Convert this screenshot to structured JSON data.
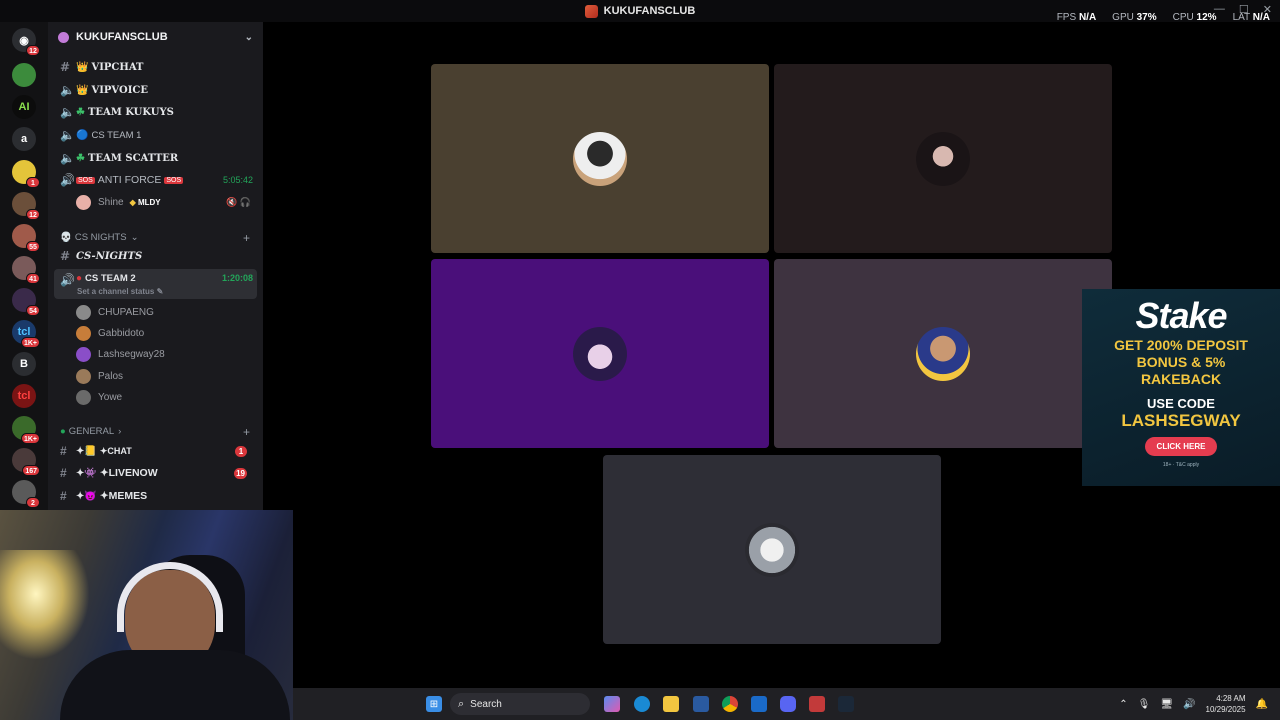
{
  "window": {
    "title": "KUKUFANSCLUB"
  },
  "perf": {
    "fps_label": "FPS",
    "fps": "N/A",
    "gpu_label": "GPU",
    "gpu": "37%",
    "cpu_label": "CPU",
    "cpu": "12%",
    "lat_label": "LAT",
    "lat": "N/A"
  },
  "rail": {
    "badges": [
      "12",
      "1",
      "12",
      "55",
      "41",
      "54",
      "1K+",
      "1K+",
      "167",
      "2"
    ],
    "letters": [
      "a",
      "B"
    ]
  },
  "server": {
    "name": "KUKUFANSCLUB"
  },
  "channels": [
    {
      "label": "VIPCHAT",
      "emoji": "👑"
    },
    {
      "label": "VIPVOICE",
      "emoji": "👑"
    },
    {
      "label": "TEAM KUKUYS",
      "emoji": "☘"
    },
    {
      "label": "CS TEAM 1",
      "emoji": "🔵"
    },
    {
      "label": "TEAM SCATTER",
      "emoji": "☘"
    },
    {
      "label": "ANTI FORCE",
      "time": "5:05:42"
    }
  ],
  "anti_force_user": {
    "name": "Shine",
    "tag": "MLDY"
  },
  "category_cs": {
    "label": "CS NIGHTS"
  },
  "cs_nights_channel": {
    "label": "CS-NIGHTS"
  },
  "cs_team2": {
    "label": "CS TEAM 2",
    "time": "1:20:08",
    "status": "Set a channel status"
  },
  "voice_users": [
    "CHUPAENG",
    "Gabbidoto",
    "Lashsegway28",
    "Palos",
    "Yowe"
  ],
  "category_general": {
    "label": "GENERAL"
  },
  "general_channels": [
    {
      "label": "✦CHAT",
      "unread": "1"
    },
    {
      "label": "✦LIVENOW",
      "unread": "19"
    },
    {
      "label": "✦MEMES"
    }
  ],
  "ad": {
    "brand": "Stake",
    "line1": "GET 200% DEPOSIT",
    "line2": "BONUS & 5%",
    "line3": "RAKEBACK",
    "code_label": "USE CODE",
    "code": "LASHSEGWAY",
    "cta": "CLICK HERE",
    "fine": "18+ · T&C apply"
  },
  "taskbar": {
    "search": "Search",
    "time": "4:28 AM",
    "date": "10/29/2025"
  },
  "colors": {
    "tile1": "#4a4030",
    "tile2": "#231b1c",
    "tile3": "#4a0f7a",
    "tile4": "#3e3340",
    "tile5": "#2e2e36",
    "green": "#23a55a"
  }
}
